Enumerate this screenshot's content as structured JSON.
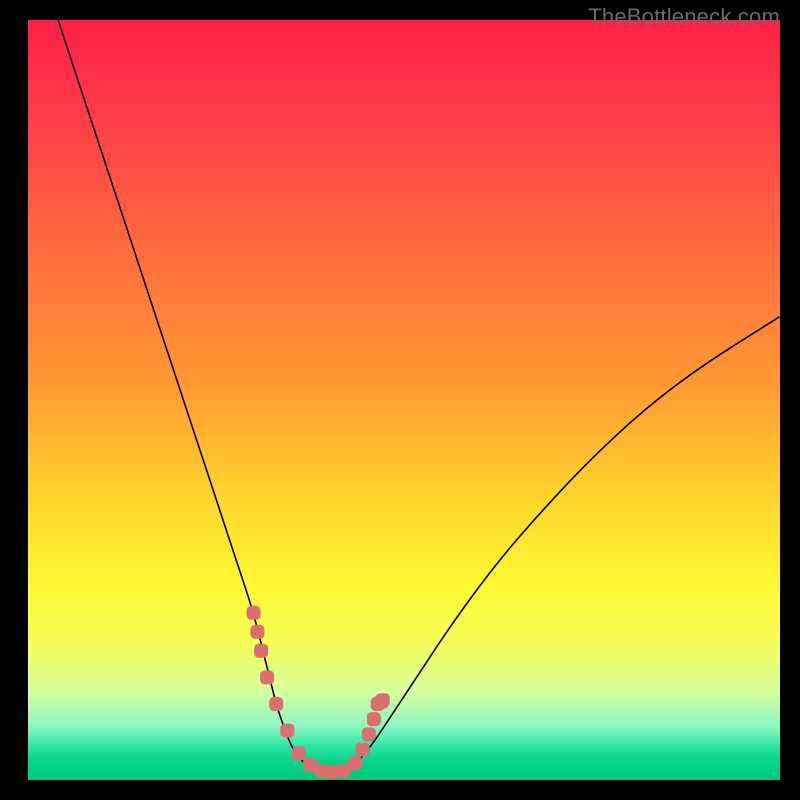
{
  "watermark": "TheBottleneck.com",
  "chart_data": {
    "type": "line",
    "title": "",
    "xlabel": "",
    "ylabel": "",
    "xlim": [
      0,
      100
    ],
    "ylim": [
      0,
      100
    ],
    "grid": false,
    "series": [
      {
        "name": "bottleneck-curve",
        "color": "#000000",
        "x": [
          4,
          6,
          8,
          10,
          12,
          14,
          16,
          18,
          20,
          22,
          24,
          26,
          28,
          30,
          32,
          33,
          34,
          35,
          36,
          37,
          38,
          39,
          40,
          41,
          42,
          44,
          46,
          48,
          52,
          56,
          60,
          64,
          68,
          72,
          76,
          80,
          84,
          88,
          92,
          96,
          100
        ],
        "y": [
          100,
          94,
          88,
          82,
          76,
          70,
          64,
          58,
          52,
          46,
          40,
          34,
          28,
          22,
          14,
          10,
          7,
          4.5,
          3,
          2,
          1.5,
          1.2,
          1,
          1,
          1.2,
          2.5,
          5,
          8,
          14,
          20,
          25.5,
          30.5,
          35,
          39.3,
          43.3,
          47,
          50.3,
          53.3,
          56,
          58.5,
          61
        ]
      },
      {
        "name": "highlight-dots",
        "color": "#d9706f",
        "x": [
          30.0,
          30.5,
          31.0,
          31.8,
          33.0,
          34.5,
          36.0,
          37.5,
          39.0,
          40.5,
          42.0,
          43.5,
          44.5,
          45.3,
          46.0,
          46.5,
          47.0,
          47.2
        ],
        "y": [
          22.0,
          19.5,
          17.0,
          13.5,
          10.0,
          6.5,
          3.5,
          2.0,
          1.2,
          1.0,
          1.2,
          2.2,
          4.0,
          6.0,
          8.0,
          10.0,
          10.3,
          10.5
        ]
      }
    ],
    "background_gradient": {
      "stops": [
        {
          "offset": 0.0,
          "color": "#ff1f47"
        },
        {
          "offset": 0.12,
          "color": "#ff3c4a"
        },
        {
          "offset": 0.3,
          "color": "#ff6b3f"
        },
        {
          "offset": 0.48,
          "color": "#ff9a33"
        },
        {
          "offset": 0.62,
          "color": "#ffd22e"
        },
        {
          "offset": 0.74,
          "color": "#fff833"
        },
        {
          "offset": 0.82,
          "color": "#f6ff5a"
        },
        {
          "offset": 0.885,
          "color": "#d6ffa0"
        },
        {
          "offset": 0.93,
          "color": "#8cf7c4"
        },
        {
          "offset": 0.955,
          "color": "#30e7a6"
        },
        {
          "offset": 0.975,
          "color": "#06d38a"
        },
        {
          "offset": 1.0,
          "color": "#00c97c"
        }
      ]
    }
  }
}
